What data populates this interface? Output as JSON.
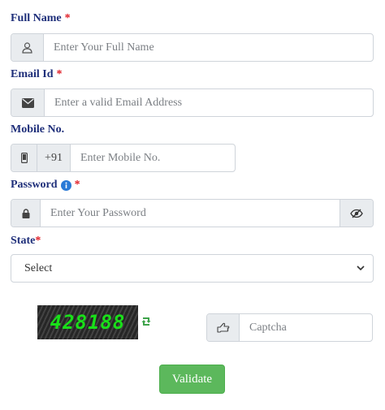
{
  "full_name": {
    "label": "Full Name",
    "required_mark": "*",
    "placeholder": "Enter Your Full Name",
    "icon": "user-icon"
  },
  "email": {
    "label": "Email Id",
    "required_mark": "*",
    "placeholder": "Enter a valid Email Address",
    "icon": "envelope-icon"
  },
  "mobile": {
    "label": "Mobile No.",
    "country_code": "+91",
    "placeholder": "Enter Mobile No.",
    "icon": "mobile-phone-icon"
  },
  "password": {
    "label": "Password",
    "required_mark": "*",
    "placeholder": "Enter Your Password",
    "info_icon": "info-icon",
    "lock_icon": "lock-icon",
    "toggle_icon": "eye-slash-icon"
  },
  "state": {
    "label": "State",
    "required_mark": "*",
    "selected": "Select"
  },
  "captcha": {
    "code": "428188",
    "placeholder": "Captcha",
    "icon": "hand-pointer-icon",
    "refresh_icon": "refresh-icon",
    "text_color": "#19e019"
  },
  "validate_button": {
    "label": "Validate",
    "color": "#5cb85c"
  },
  "colors": {
    "label": "#1f2f7a",
    "required": "#e01a22",
    "info": "#2a7ad6"
  }
}
